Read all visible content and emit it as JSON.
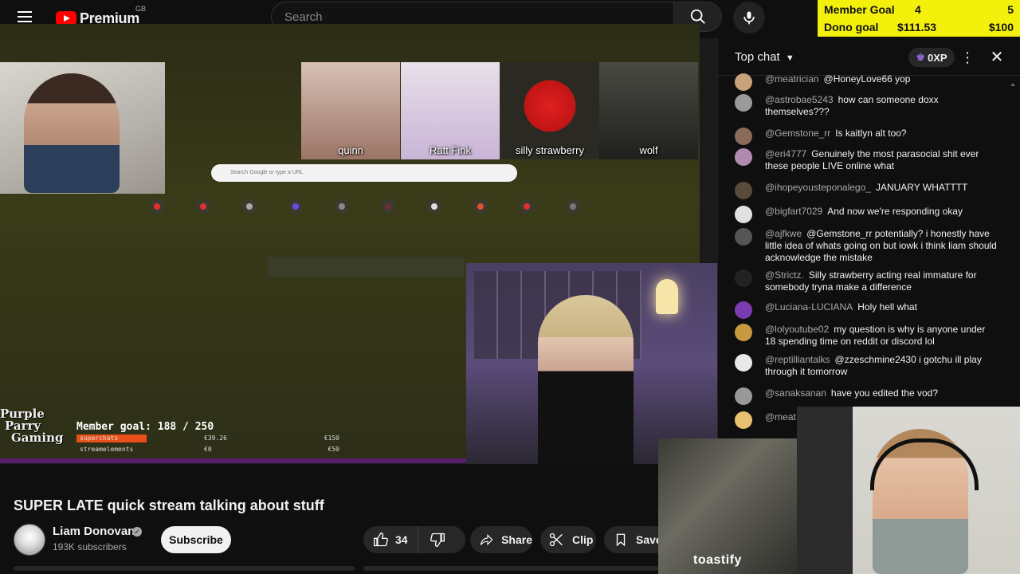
{
  "header": {
    "logo_text": "Premium",
    "region": "GB",
    "search_placeholder": "Search"
  },
  "goal_overlay": {
    "member_label": "Member Goal",
    "member_current": "4",
    "member_target": "5",
    "dono_label": "Dono goal",
    "dono_current": "$111.53",
    "dono_target": "$100",
    "color": "#f3f10c"
  },
  "stream": {
    "avatar_names": [
      "quinn",
      "Ratt Fink",
      "silly strawberry",
      "wolf"
    ],
    "browser_search_placeholder": "Search Google or type a URL",
    "brand_lines": [
      "Purple",
      "Parry",
      "Gaming"
    ],
    "inner_goal": "Member goal: 188 / 250",
    "inner_goal_rows": [
      {
        "label": "superchats",
        "current": "€39.26",
        "target": "€150"
      },
      {
        "label": "streamelements",
        "current": "€0",
        "target": "€50"
      }
    ]
  },
  "video": {
    "title": "SUPER LATE quick stream talking about stuff",
    "channel": "Liam Donovan",
    "subscribers": "193K subscribers",
    "subscribe_label": "Subscribe",
    "likes": "34",
    "share_label": "Share",
    "clip_label": "Clip",
    "save_label": "Save"
  },
  "chat": {
    "mode": "Top chat",
    "xp": "0XP",
    "messages": [
      {
        "user": "@meatrician",
        "text": "@HoneyLove66 yop",
        "color": "#c7a27a"
      },
      {
        "user": "@astrobae5243",
        "text": "how can someone doxx themselves???",
        "color": "#9a9a9a"
      },
      {
        "user": "@Gemstone_rr",
        "text": "Is kaitlyn alt too?",
        "color": "#8a6a5a"
      },
      {
        "user": "@eri4777",
        "text": "Genuinely the most parasocial shit ever these people LIVE online what",
        "color": "#b08ab0"
      },
      {
        "user": "@ihopeyousteponalego_",
        "text": "JANUARY WHATTTT",
        "color": "#5a4a3a"
      },
      {
        "user": "@bigfart7029",
        "text": "And now we're responding okay",
        "color": "#e0e0e0"
      },
      {
        "user": "@ajfkwe",
        "text": "@Gemstone_rr potentially? i honestly have little idea of whats going on but iowk i think liam should acknowledge the mistake",
        "color": "#555555"
      },
      {
        "user": "@Strictz.",
        "text": "Silly strawberry acting real immature for somebody tryna make a difference",
        "color": "#222222"
      },
      {
        "user": "@Luciana-LUCIANA",
        "text": "Holy hell what",
        "color": "#7a3ab0"
      },
      {
        "user": "@lolyoutube02",
        "text": "my question is why is anyone under 18 spending time on reddit or discord lol",
        "color": "#c89a40"
      },
      {
        "user": "@reptilliantalks",
        "text": "@zzeschmine2430 i gotchu ill play through it tomorrow",
        "color": "#e8e8e8"
      },
      {
        "user": "@sanaksanan",
        "text": "have you edited the vod?",
        "color": "#999999"
      },
      {
        "user": "@meat",
        "text": "",
        "color": "#e8c070"
      }
    ]
  },
  "overlay": {
    "sticker_label": "toastify"
  }
}
